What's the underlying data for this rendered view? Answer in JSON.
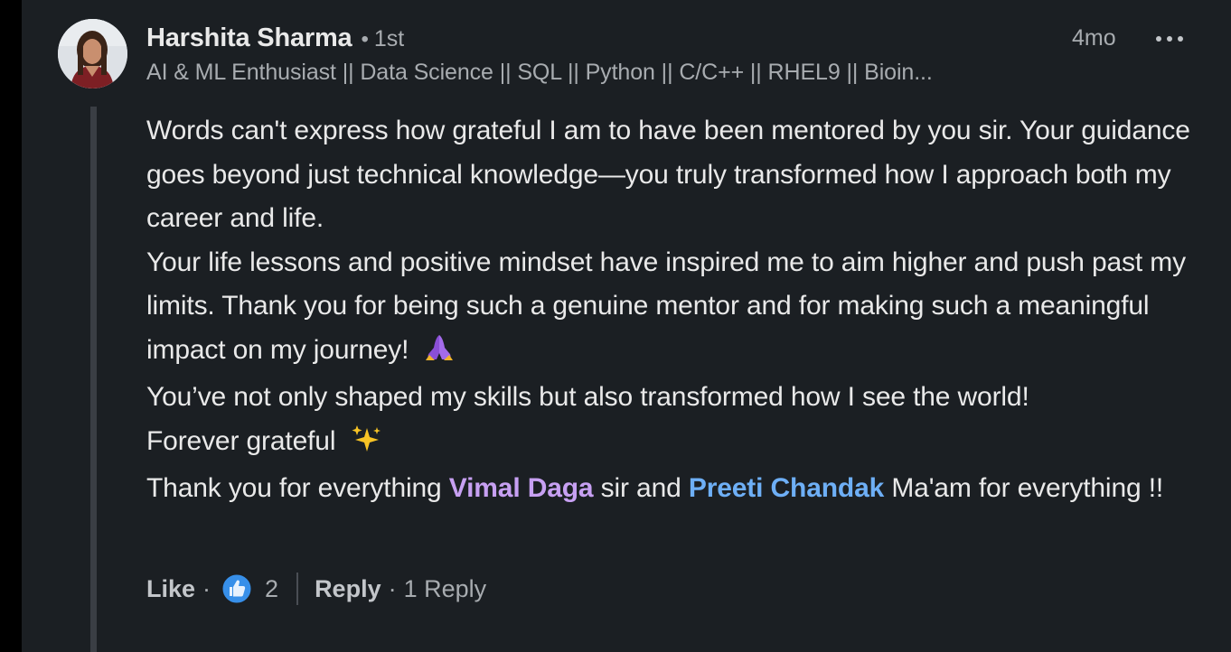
{
  "author": {
    "name": "Harshita Sharma",
    "separator": "•",
    "degree": "1st",
    "headline": "AI & ML Enthusiast || Data Science || SQL || Python || C/C++ || RHEL9 || Bioin..."
  },
  "meta": {
    "time": "4mo",
    "more_icon": "more-horizontal-icon"
  },
  "comment": {
    "line1": "Words can't express how grateful I am to have been mentored by you sir. Your guidance goes beyond just technical knowledge—you truly transformed how I approach both my career and life.",
    "line2": "Your life lessons and positive mindset have inspired me to aim higher and push past my limits. Thank you for being such a genuine mentor and for making such a meaningful impact on my journey!",
    "line3": "You’ve not only shaped my skills but also transformed how I see the world!",
    "line4": "Forever grateful",
    "line5_prefix": "Thank you for everything ",
    "mention1": "Vimal Daga",
    "line5_middle": " sir and ",
    "mention2": "Preeti Chandak",
    "line5_suffix": " Ma'am for everything !!",
    "emoji_pray": "folded-hands-icon",
    "emoji_sparkles": "sparkles-icon"
  },
  "actions": {
    "like_label": "Like",
    "dot": "·",
    "like_count": "2",
    "reply_label": "Reply",
    "reply_count": "1 Reply",
    "reaction_icon": "thumbs-up-reaction-icon"
  },
  "colors": {
    "background": "#1b1f23",
    "text_primary": "#e9e9e9",
    "text_secondary": "#a8acb0",
    "mention_purple": "#c7a0f2",
    "mention_blue": "#6eaff6",
    "like_blue": "#378fe9"
  }
}
